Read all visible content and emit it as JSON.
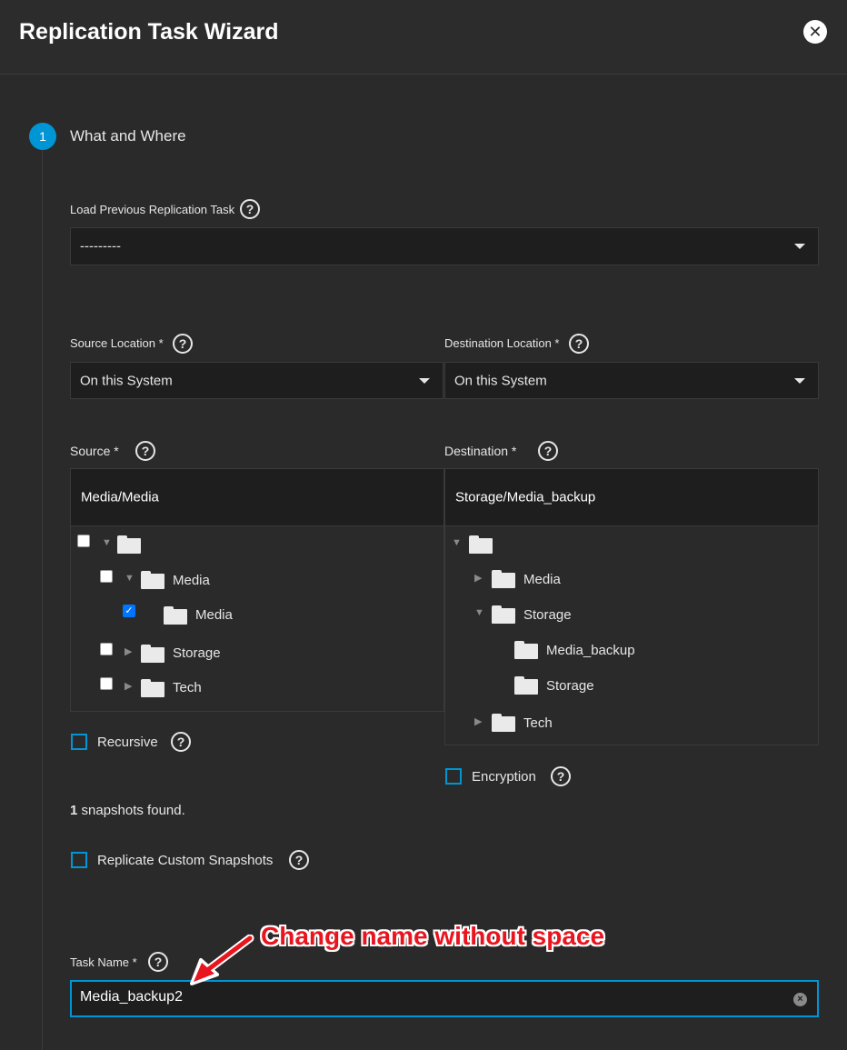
{
  "dialog": {
    "title": "Replication Task Wizard",
    "close_label": "✕"
  },
  "step": {
    "number": "1",
    "title": "What and Where"
  },
  "load_previous": {
    "label": "Load Previous Replication Task",
    "value": "---------"
  },
  "source_location": {
    "label": "Source Location *",
    "value": "On this System"
  },
  "destination_location": {
    "label": "Destination Location *",
    "value": "On this System"
  },
  "source": {
    "label": "Source *",
    "selected_path": "Media/Media",
    "tree": [
      {
        "label": "",
        "checked": false,
        "expanded": true,
        "depth": 0
      },
      {
        "label": "Media",
        "checked": false,
        "expanded": true,
        "depth": 1
      },
      {
        "label": "Media",
        "checked": true,
        "depth": 2
      },
      {
        "label": "Storage",
        "checked": false,
        "expanded": false,
        "depth": 1
      },
      {
        "label": "Tech",
        "checked": false,
        "expanded": false,
        "depth": 1
      }
    ]
  },
  "destination": {
    "label": "Destination *",
    "selected_path": "Storage/Media_backup",
    "tree": [
      {
        "label": "",
        "expanded": true,
        "depth": 0
      },
      {
        "label": "Media",
        "expanded": false,
        "depth": 1
      },
      {
        "label": "Storage",
        "expanded": true,
        "depth": 1
      },
      {
        "label": "Media_backup",
        "depth": 2
      },
      {
        "label": "Storage",
        "depth": 2
      },
      {
        "label": "Tech",
        "expanded": false,
        "depth": 1
      }
    ]
  },
  "recursive": {
    "label": "Recursive",
    "checked": false
  },
  "encryption": {
    "label": "Encryption",
    "checked": false
  },
  "snapshots": {
    "count": "1",
    "text": "snapshots found."
  },
  "replicate_custom": {
    "label": "Replicate Custom Snapshots",
    "checked": false
  },
  "task_name": {
    "label": "Task Name *",
    "value": "Media_backup2"
  },
  "annotation": {
    "text": "Change name without space",
    "color": "#e8141e"
  },
  "help_glyph": "?",
  "colors": {
    "accent": "#0095d5",
    "background": "#2a2a2a",
    "field": "#1e1e1e"
  }
}
